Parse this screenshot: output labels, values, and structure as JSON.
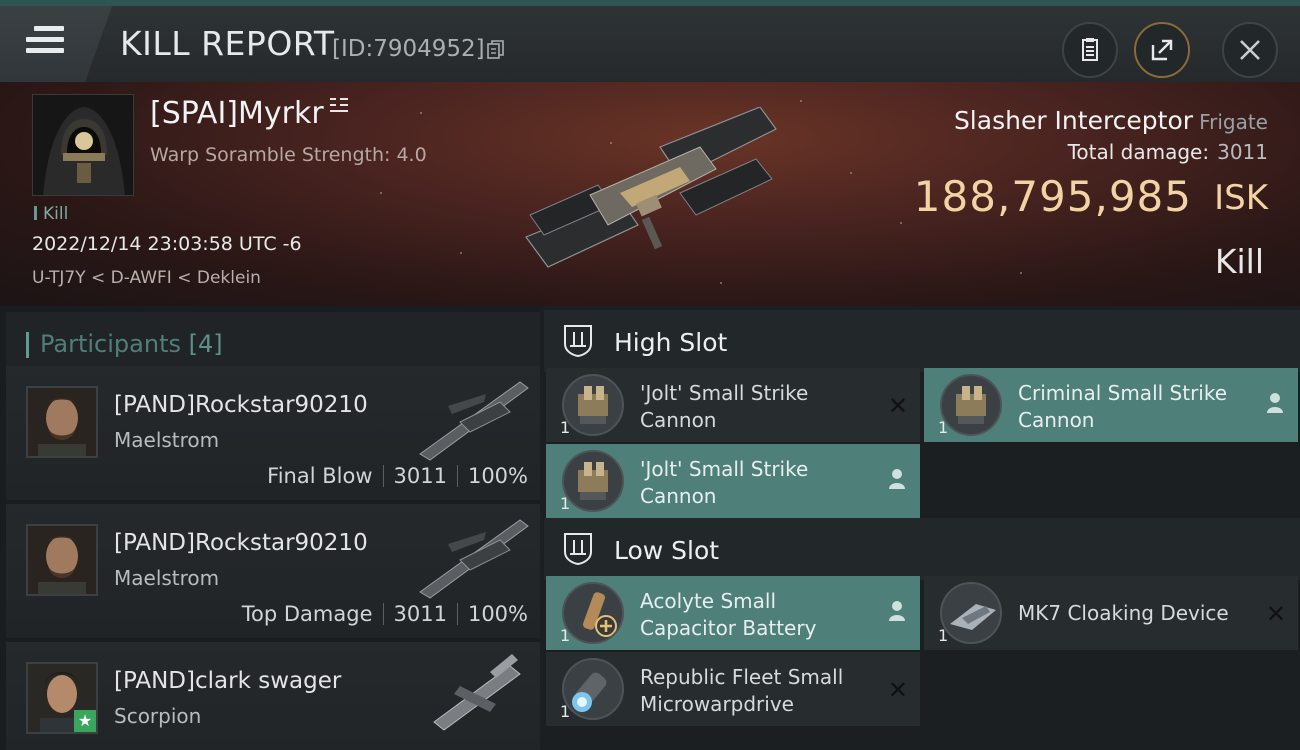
{
  "header": {
    "title": "KILL REPORT",
    "report_id": "[ID:7904952]",
    "icons": [
      "menu-icon",
      "copy-icon",
      "clipboard-icon",
      "share-icon",
      "close-icon"
    ]
  },
  "victim": {
    "name": "[SPAI]Myrkr",
    "warp_scramble": "Warp Soramble Strength: 4.0",
    "tag": "Kill",
    "datetime": "2022/12/14 23:03:58 UTC -6",
    "location": "U-TJ7Y < D-AWFI < Deklein",
    "ship_name": "Slasher Interceptor",
    "ship_class": "Frigate",
    "total_damage_label": "Total damage:",
    "total_damage": "3011",
    "isk_value": "188,795,985",
    "isk_unit": "ISK",
    "result": "Kill"
  },
  "participants": {
    "title": "Participants",
    "count": "[4]",
    "rows": [
      {
        "name": "[PAND]Rockstar90210",
        "ship": "Maelstrom",
        "role": "Final Blow",
        "damage": "3011",
        "percent": "100%"
      },
      {
        "name": "[PAND]Rockstar90210",
        "ship": "Maelstrom",
        "role": "Top Damage",
        "damage": "3011",
        "percent": "100%"
      },
      {
        "name": "[PAND]clark swager",
        "ship": "Scorpion",
        "role": "",
        "damage": "",
        "percent": ""
      }
    ]
  },
  "fitting": {
    "high_slot": {
      "label": "High Slot",
      "modules": [
        {
          "name": "'Jolt' Small Strike Cannon",
          "qty": "1",
          "status": "destroyed"
        },
        {
          "name": "Criminal Small Strike Cannon",
          "qty": "1",
          "status": "dropped"
        },
        {
          "name": "'Jolt' Small Strike Cannon",
          "qty": "1",
          "status": "dropped"
        }
      ]
    },
    "low_slot": {
      "label": "Low Slot",
      "modules": [
        {
          "name": "Acolyte Small Capacitor Battery",
          "qty": "1",
          "status": "dropped"
        },
        {
          "name": "MK7 Cloaking Device",
          "qty": "1",
          "status": "destroyed"
        },
        {
          "name": "Republic Fleet Small Microwarpdrive",
          "qty": "1",
          "status": "destroyed"
        }
      ]
    },
    "x_mark": "✕"
  },
  "colors": {
    "accent_teal": "#4f7f79",
    "isk_gold": "#f2d3a3"
  }
}
